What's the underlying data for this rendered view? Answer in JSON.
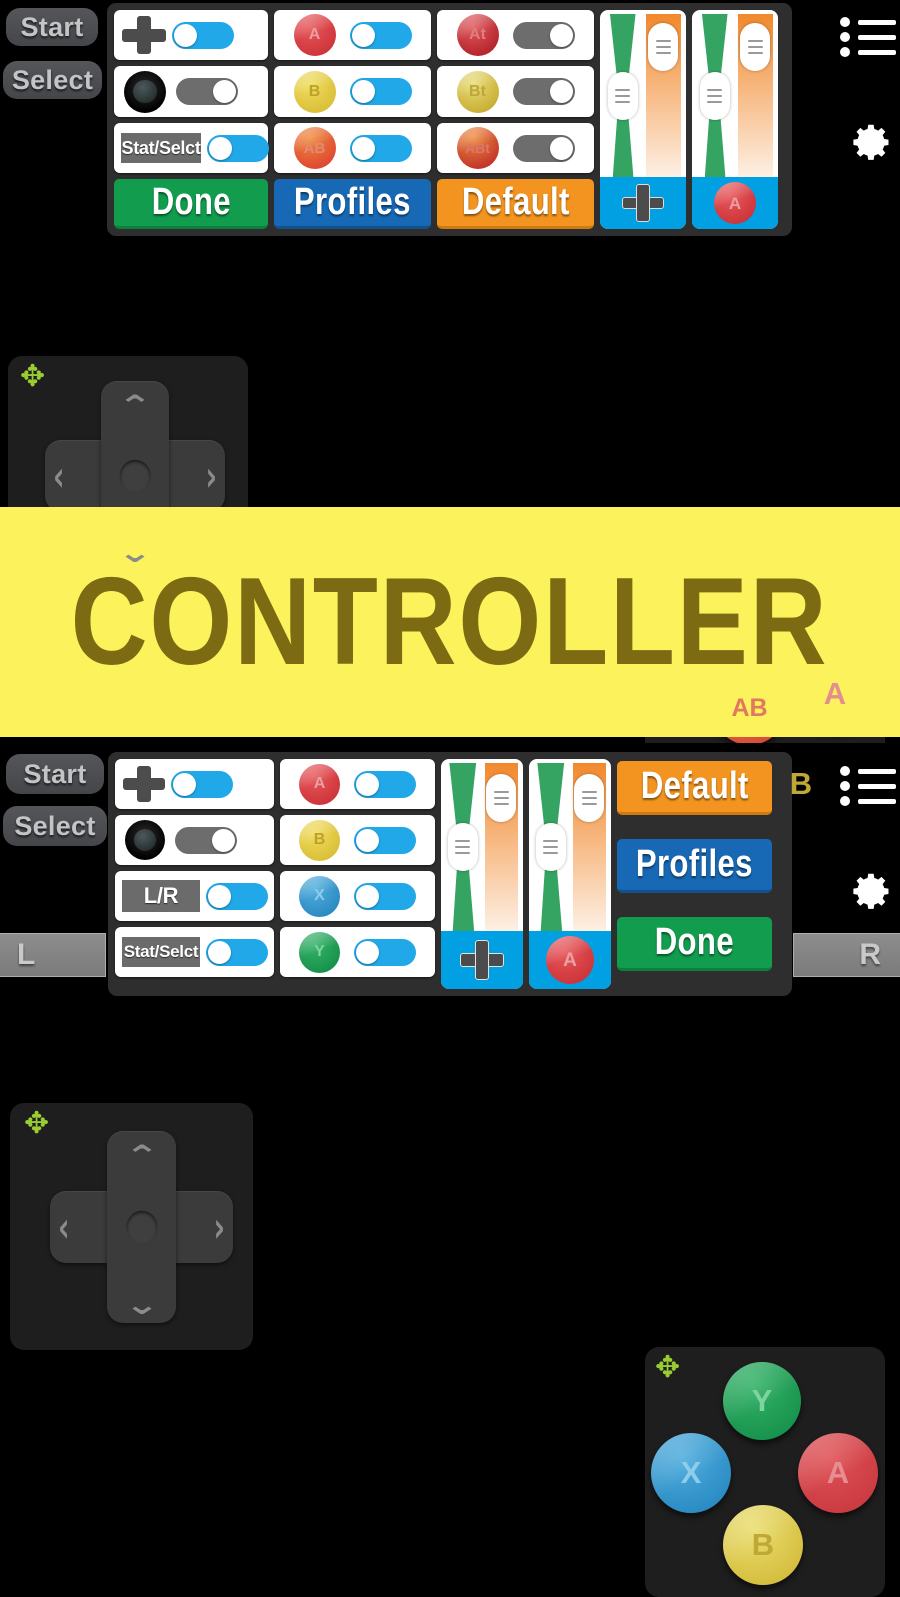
{
  "app": {
    "title": "CONTROLLER",
    "banner_bg": "#fbf25c",
    "banner_fg": "#7c6b12"
  },
  "colors": {
    "toggle_on": "#20a8e8",
    "toggle_off": "#6d6d6d",
    "done": "#119c4e",
    "profiles": "#1769b5",
    "default": "#f2941f",
    "slider_green": "#35a463",
    "slider_orange": "#f2882c",
    "slider_foot": "#00a0e3",
    "btn_a": "#d93a3f",
    "btn_b": "#e0c83c",
    "btn_x": "#2f93cf",
    "btn_y": "#1d9d52",
    "btn_ab": "#e0582f",
    "move_handle": "#9acd32"
  },
  "top_screen": {
    "start_label": "Start",
    "select_label": "Select",
    "menu_icon": "list-icon",
    "settings_icon": "gear-icon",
    "config_rows": [
      [
        {
          "icon": "dpad-icon",
          "label": "",
          "toggle": "on"
        },
        {
          "icon": "circle-a",
          "label": "A",
          "toggle": "on"
        },
        {
          "icon": "circle-at",
          "label": "At",
          "toggle": "off"
        }
      ],
      [
        {
          "icon": "joystick-icon",
          "label": "",
          "toggle": "off"
        },
        {
          "icon": "circle-b",
          "label": "B",
          "toggle": "on"
        },
        {
          "icon": "circle-bt",
          "label": "Bt",
          "toggle": "off"
        }
      ],
      [
        {
          "icon": "chip-text",
          "label": "Stat/Selct",
          "toggle": "on"
        },
        {
          "icon": "circle-ab",
          "label": "AB",
          "toggle": "on"
        },
        {
          "icon": "circle-abt",
          "label": "ABt",
          "toggle": "off"
        }
      ]
    ],
    "actions": [
      {
        "name": "done",
        "label": "Done"
      },
      {
        "name": "profiles",
        "label": "Profiles"
      },
      {
        "name": "default",
        "label": "Default"
      }
    ],
    "sliders": [
      {
        "name": "dpad-size-slider",
        "foot_icon": "dpad-icon",
        "foot_label": ""
      },
      {
        "name": "abtn-size-slider",
        "foot_icon": "circle-a",
        "foot_label": "A"
      }
    ],
    "dpad_widget": {
      "name": "dpad-pad",
      "handle": "move-handle"
    },
    "buttons_widget": {
      "name": "face-buttons",
      "handle": "move-handle",
      "buttons": [
        {
          "label": "AB",
          "color": "#e0582f"
        },
        {
          "label": "A",
          "color": "#d93a3f"
        },
        {
          "label": "B",
          "color": "#e0c83c"
        }
      ]
    }
  },
  "bottom_screen": {
    "start_label": "Start",
    "select_label": "Select",
    "shoulder_left": "L",
    "shoulder_right": "R",
    "menu_icon": "list-icon",
    "settings_icon": "gear-icon",
    "config_left": [
      {
        "icon": "dpad-icon",
        "label": "",
        "toggle": "on"
      },
      {
        "icon": "joystick-icon",
        "label": "",
        "toggle": "off"
      },
      {
        "icon": "chip-text",
        "label": "L/R",
        "toggle": "on"
      },
      {
        "icon": "chip-text",
        "label": "Stat/Selct",
        "toggle": "on"
      }
    ],
    "config_right": [
      {
        "icon": "circle-a",
        "label": "A",
        "toggle": "on"
      },
      {
        "icon": "circle-b",
        "label": "B",
        "toggle": "on"
      },
      {
        "icon": "circle-x",
        "label": "X",
        "toggle": "on"
      },
      {
        "icon": "circle-y",
        "label": "Y",
        "toggle": "on"
      }
    ],
    "sliders": [
      {
        "name": "dpad-size-slider",
        "foot_icon": "dpad-icon",
        "foot_label": ""
      },
      {
        "name": "abtn-size-slider",
        "foot_icon": "circle-a",
        "foot_label": "A"
      }
    ],
    "actions": [
      {
        "name": "default",
        "label": "Default"
      },
      {
        "name": "profiles",
        "label": "Profiles"
      },
      {
        "name": "done",
        "label": "Done"
      }
    ],
    "dpad_widget": {
      "name": "dpad-pad",
      "handle": "move-handle"
    },
    "buttons_widget": {
      "name": "face-buttons",
      "handle": "move-handle",
      "buttons": [
        {
          "label": "Y",
          "color": "#1d9d52"
        },
        {
          "label": "X",
          "color": "#2f93cf"
        },
        {
          "label": "A",
          "color": "#d93a3f"
        },
        {
          "label": "B",
          "color": "#e0c83c"
        }
      ]
    }
  }
}
